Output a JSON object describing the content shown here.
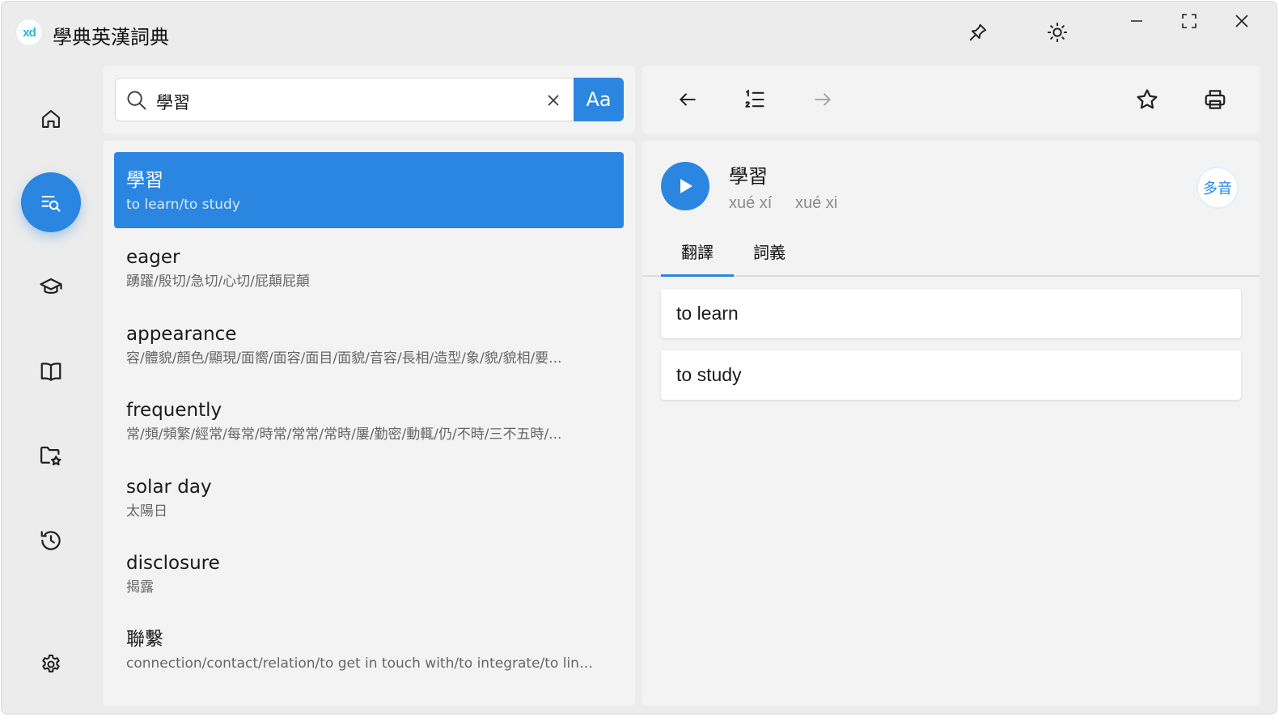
{
  "app": {
    "title": "學典英漢詞典",
    "logo_text": "xd"
  },
  "titlebar": {
    "icons": [
      "pin-icon",
      "brightness-icon",
      "minimize-icon",
      "fullscreen-icon",
      "close-icon"
    ]
  },
  "nav": {
    "items": [
      {
        "name": "home",
        "icon": "home-icon",
        "active": false
      },
      {
        "name": "search",
        "icon": "search-list-icon",
        "active": true
      },
      {
        "name": "learn",
        "icon": "graduation-cap-icon",
        "active": false
      },
      {
        "name": "dictionary",
        "icon": "book-icon",
        "active": false
      },
      {
        "name": "favorites",
        "icon": "folder-star-icon",
        "active": false
      },
      {
        "name": "history",
        "icon": "history-icon",
        "active": false
      },
      {
        "name": "settings",
        "icon": "gear-icon",
        "active": false
      }
    ]
  },
  "search": {
    "value": "學習",
    "case_button_label": "Aa"
  },
  "results": [
    {
      "word": "學習",
      "definition": "to learn/to study",
      "selected": true
    },
    {
      "word": "eager",
      "definition": "踴躍/殷切/急切/心切/屁顛屁顛",
      "selected": false
    },
    {
      "word": "appearance",
      "definition": "容/體貌/顏色/顯現/面嚮/面容/面目/面貌/音容/長相/造型/象/貌/貌相/要...",
      "selected": false
    },
    {
      "word": "frequently",
      "definition": "常/頻/頻繁/經常/每常/時常/常常/常時/屢/勤密/動輒/仍/不時/三不五時/...",
      "selected": false
    },
    {
      "word": "solar day",
      "definition": "太陽日",
      "selected": false
    },
    {
      "word": "disclosure",
      "definition": "揭露",
      "selected": false
    },
    {
      "word": "聯繫",
      "definition": "connection/contact/relation/to get in touch with/to integrate/to link/to...",
      "selected": false
    }
  ],
  "detail": {
    "headword": "學習",
    "pinyin": [
      "xué xí",
      "xué xi"
    ],
    "polyphone_label": "多音",
    "tabs": [
      {
        "label": "翻譯",
        "active": true
      },
      {
        "label": "詞義",
        "active": false
      }
    ],
    "meanings": [
      "to learn",
      "to study"
    ]
  },
  "colors": {
    "accent": "#2a86e0",
    "window_bg": "#ececec",
    "panel_bg": "#f3f3f3"
  }
}
